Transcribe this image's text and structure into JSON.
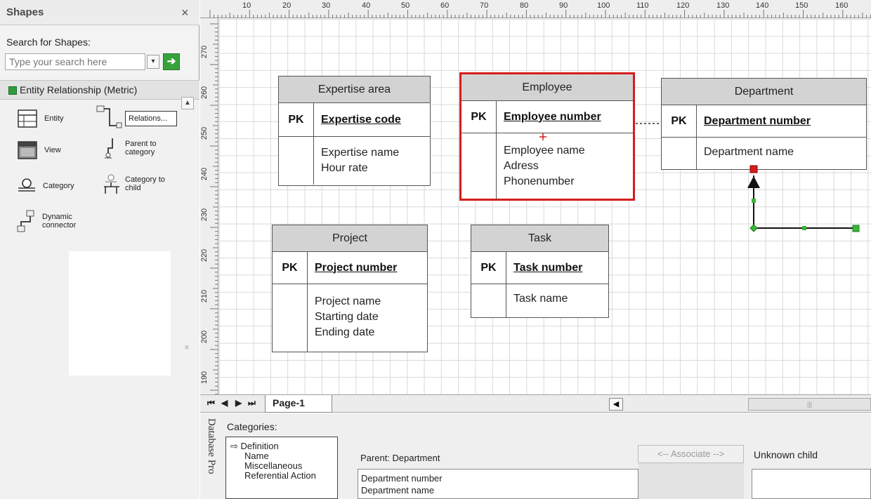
{
  "shapes_panel": {
    "title": "Shapes",
    "close_icon": "×",
    "search_label": "Search for Shapes:",
    "search_placeholder": "Type your search here",
    "search_drop_icon": "▾",
    "search_go_icon": "➔",
    "stencil_title": "Entity Relationship (Metric)",
    "scroll_up_icon": "▲",
    "grip_icon": "≡",
    "shapes": [
      {
        "label": "Entity",
        "icon": "entity-icon"
      },
      {
        "label": "Relations...",
        "icon": "relationship-icon"
      },
      {
        "label": "View",
        "icon": "view-icon"
      },
      {
        "label": "Parent to category",
        "icon": "parent-to-category-icon"
      },
      {
        "label": "Category",
        "icon": "category-icon"
      },
      {
        "label": "Category to child",
        "icon": "category-to-child-icon"
      },
      {
        "label": "Dynamic connector",
        "icon": "dynamic-connector-icon"
      }
    ]
  },
  "rulers": {
    "top": [
      "10",
      "20",
      "30",
      "40",
      "50",
      "60",
      "70",
      "80",
      "90",
      "100",
      "110",
      "120",
      "130",
      "140",
      "150",
      "160"
    ],
    "left": [
      "270",
      "260",
      "250",
      "240",
      "230",
      "220",
      "210",
      "200",
      "190"
    ]
  },
  "entities": [
    {
      "name": "Expertise area",
      "pk_label": "PK",
      "key": "Expertise code",
      "attributes": [
        "Expertise name",
        "Hour rate"
      ]
    },
    {
      "name": "Employee",
      "pk_label": "PK",
      "key": "Employee number",
      "attributes": [
        "Employee name",
        "Adress",
        "Phonenumber"
      ]
    },
    {
      "name": "Department",
      "pk_label": "PK",
      "key": "Department number",
      "attributes": [
        "Department name"
      ]
    },
    {
      "name": "Project",
      "pk_label": "PK",
      "key": "Project number",
      "attributes": [
        "Project name",
        "Starting date",
        "Ending date"
      ]
    },
    {
      "name": "Task",
      "pk_label": "PK",
      "key": "Task number",
      "attributes": [
        "Task name"
      ]
    }
  ],
  "page_tabs": {
    "first_icon": "⏮",
    "prev_icon": "◀",
    "next_icon": "▶",
    "last_icon": "⏭",
    "active_tab": "Page-1",
    "scroll_left_icon": "◀",
    "thumb_grip": "|||"
  },
  "database_properties": {
    "panel_title": "Database Pro",
    "categories_label": "Categories:",
    "categories": [
      "Definition",
      "Name",
      "Miscellaneous",
      "Referential Action"
    ],
    "selected_category": "Definition",
    "selected_icon": "⇨",
    "parent_label": "Parent: Department",
    "parent_fields": [
      "Department number",
      "Department name"
    ],
    "associate_button": "<-- Associate -->",
    "child_label": "Unknown child"
  },
  "colors": {
    "selection_border": "#d51d1d",
    "entity_header": "#d3d3d3",
    "connector_handle": "#d51d1d",
    "connection_point": "#36b636"
  }
}
